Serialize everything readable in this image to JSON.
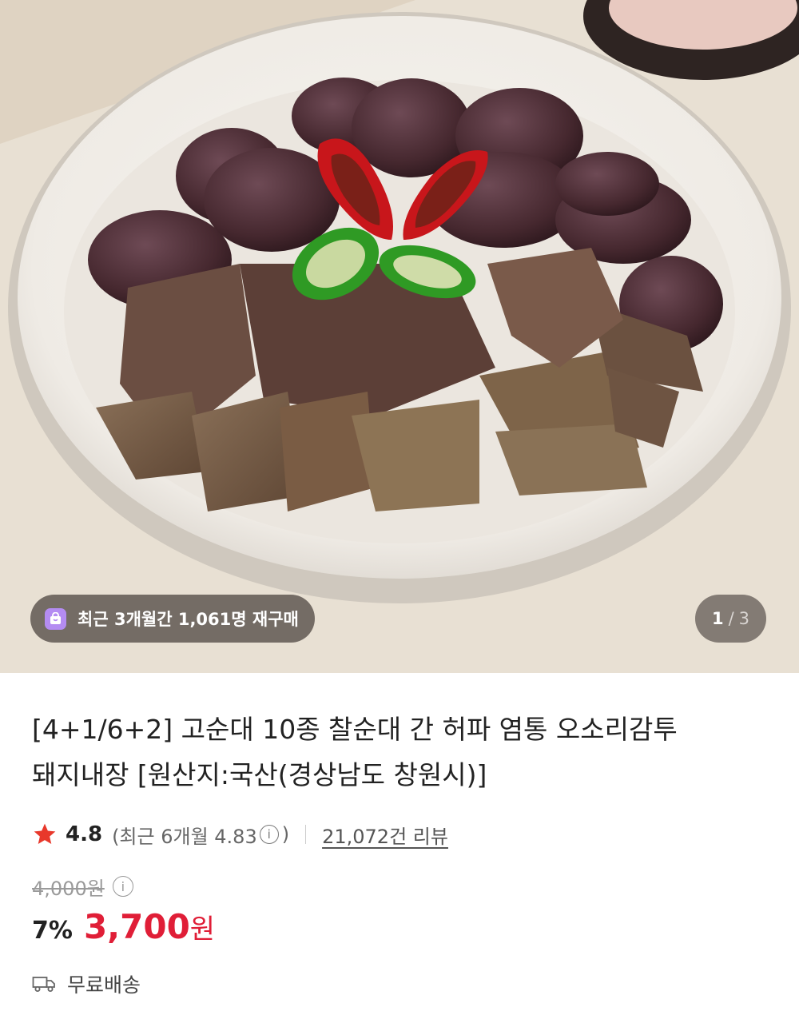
{
  "hero": {
    "badge_text": "최근 3개월간 1,061명 재구매",
    "badge_icon": "shopping-bag-icon",
    "counter_current": "1",
    "counter_separator": "/",
    "counter_total": "3"
  },
  "product": {
    "title_line1": "[4+1/6+2] 고순대 10종 찰순대 간 허파 염통 오소리감투",
    "title_line2": "돼지내장 [원산지:국산(경상남도 창원시)]"
  },
  "rating": {
    "star_icon": "star-icon",
    "star_color": "#e8382b",
    "score": "4.8",
    "recent_prefix": "(최근 6개월 4.83",
    "recent_suffix": ")",
    "info_glyph": "i",
    "review_count": "21,072건 리뷰"
  },
  "price": {
    "original": "4,000원",
    "discount": "7%",
    "sale_amount": "3,700",
    "currency": "원",
    "accent_color": "#e01e37"
  },
  "shipping": {
    "icon": "truck-icon",
    "label": "무료배송"
  }
}
